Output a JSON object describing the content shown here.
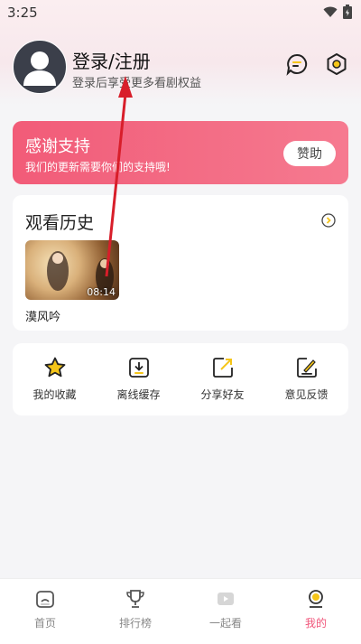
{
  "status_bar": {
    "time": "3:25"
  },
  "profile": {
    "title": "登录/注册",
    "subtitle": "登录后享受更多看剧权益"
  },
  "support_banner": {
    "title": "感谢支持",
    "subtitle": "我们的更新需要你们的支持哦!",
    "button": "赞助"
  },
  "history": {
    "title": "观看历史",
    "items": [
      {
        "title": "漠风吟",
        "duration": "08:14"
      }
    ]
  },
  "tools": [
    {
      "label": "我的收藏",
      "icon": "star-icon"
    },
    {
      "label": "离线缓存",
      "icon": "download-icon"
    },
    {
      "label": "分享好友",
      "icon": "share-icon"
    },
    {
      "label": "意见反馈",
      "icon": "feedback-icon"
    }
  ],
  "tabs": [
    {
      "label": "首页",
      "icon": "home-icon",
      "active": false
    },
    {
      "label": "排行榜",
      "icon": "trophy-icon",
      "active": false
    },
    {
      "label": "一起看",
      "icon": "watch-together-icon",
      "active": false
    },
    {
      "label": "我的",
      "icon": "profile-icon",
      "active": true
    }
  ],
  "colors": {
    "accent": "#f0557a",
    "banner": "#f25b78",
    "icon_dark": "#333333",
    "badge_yellow": "#f5c518"
  }
}
